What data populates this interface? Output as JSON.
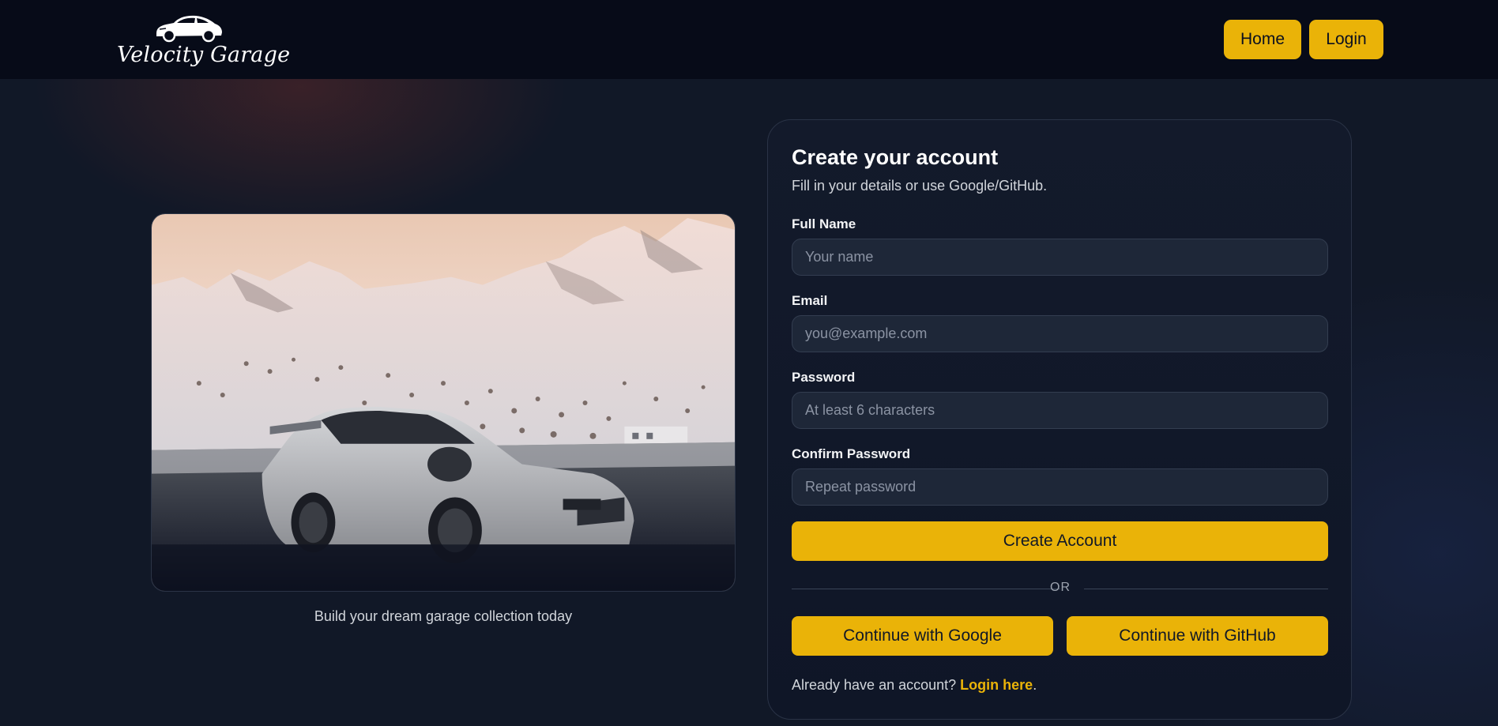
{
  "app": {
    "brand_name": "Velocity Garage",
    "logo_icon": "car-logo-icon"
  },
  "nav": {
    "home_label": "Home",
    "login_label": "Login"
  },
  "hero": {
    "caption": "Build your dream garage collection today"
  },
  "form": {
    "title": "Create your account",
    "subtitle": "Fill in your details or use Google/GitHub.",
    "full_name": {
      "label": "Full Name",
      "placeholder": "Your name",
      "value": ""
    },
    "email": {
      "label": "Email",
      "placeholder": "you@example.com",
      "value": ""
    },
    "password": {
      "label": "Password",
      "placeholder": "At least 6 characters",
      "value": ""
    },
    "confirm_password": {
      "label": "Confirm Password",
      "placeholder": "Repeat password",
      "value": ""
    },
    "submit_label": "Create Account",
    "divider_label": "OR",
    "google_label": "Continue with Google",
    "github_label": "Continue with GitHub",
    "footer_prefix": "Already have an account?",
    "footer_link": "Login here",
    "footer_suffix": "."
  },
  "colors": {
    "accent": "#eab308",
    "navbar": "#070b18",
    "background": "#111827",
    "input_bg": "#1e2738"
  }
}
